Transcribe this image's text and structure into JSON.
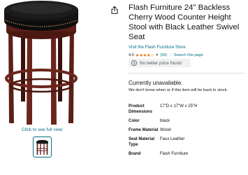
{
  "product": {
    "title": "Flash Furniture 24\" Backless Cherry Wood Counter Height Stool with Black Leather Swivel Seat",
    "store_link": "Visit the Flash Furniture Store",
    "rating_value": "4.0",
    "stars_glyphs": "★★★★☆",
    "rating_count": "(55)",
    "separator": "|",
    "search_link": "Search this page",
    "price_badge": "No better price found"
  },
  "availability": {
    "status": "Currently unavailable.",
    "note": "We don't know when or if this item will be back in stock."
  },
  "gallery": {
    "view_link": "Click to see full view"
  },
  "specs": [
    {
      "key": "Product Dimensions",
      "value": "17\"D x 17\"W x 25\"H"
    },
    {
      "key": "Color",
      "value": "black"
    },
    {
      "key": "Frame Material",
      "value": "Wood"
    },
    {
      "key": "Seat Material Type",
      "value": "Faux Leather"
    },
    {
      "key": "Brand",
      "value": "Flash Furniture"
    }
  ],
  "colors": {
    "link": "#007185",
    "star": "#e67a00",
    "wood": "#5a2018",
    "seat": "#141414"
  },
  "icons": [
    "share-icon",
    "price-tag-icon",
    "chevron-down-icon"
  ]
}
